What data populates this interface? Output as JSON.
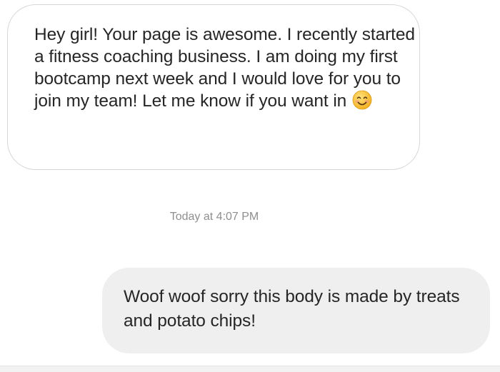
{
  "thread": {
    "received_message": {
      "text": "Hey girl! Your page is awesome. I recently started a fitness coaching business. I am doing my first bootcamp next week and I would love for you to join my team! Let me know if you want in",
      "emoji": "smiling-face-emoji"
    },
    "timestamp": "Today at 4:07 PM",
    "sent_message": {
      "text": "Woof woof sorry this body is made by treats and potato chips!"
    }
  },
  "colors": {
    "received_bubble_border": "#d7d7d7",
    "sent_bubble_bg": "#efefef",
    "message_text": "#262626",
    "timestamp_text": "#8e8e8e",
    "emoji_face": "#f8c53a"
  }
}
